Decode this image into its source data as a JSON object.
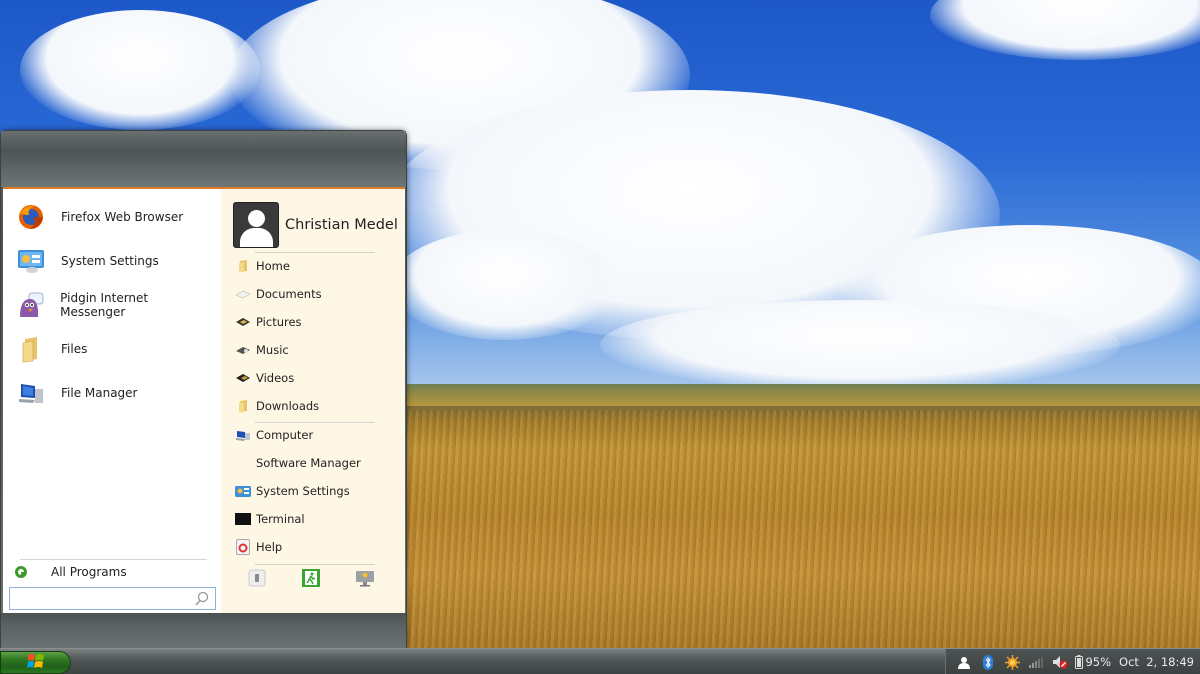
{
  "desktop": {
    "wallpaper": "Wheat field under blue sky with clouds"
  },
  "start_menu": {
    "pinned_apps": [
      {
        "label": "Firefox Web Browser",
        "icon": "firefox-icon"
      },
      {
        "label": "System Settings",
        "icon": "system-settings-icon"
      },
      {
        "label": "Pidgin Internet Messenger",
        "icon": "pidgin-icon"
      },
      {
        "label": "Files",
        "icon": "folder-icon"
      },
      {
        "label": "File Manager",
        "icon": "computer-icon"
      }
    ],
    "all_programs_label": "All Programs",
    "search": {
      "value": "",
      "placeholder": ""
    },
    "user": {
      "name": "Christian Medel"
    },
    "places": [
      {
        "label": "Home",
        "icon": "folder-icon"
      },
      {
        "label": "Documents",
        "icon": "documents-icon"
      },
      {
        "label": "Pictures",
        "icon": "pictures-icon"
      },
      {
        "label": "Music",
        "icon": "music-icon"
      },
      {
        "label": "Videos",
        "icon": "videos-icon"
      },
      {
        "label": "Downloads",
        "icon": "folder-icon"
      }
    ],
    "system": [
      {
        "label": "Computer",
        "icon": "computer-icon"
      },
      {
        "label": "Software Manager",
        "icon": ""
      },
      {
        "label": "System Settings",
        "icon": "system-settings-icon"
      },
      {
        "label": "Terminal",
        "icon": "terminal-icon"
      },
      {
        "label": "Help",
        "icon": "help-icon"
      }
    ],
    "actions": [
      {
        "name": "lock-screen",
        "icon": "lock-icon"
      },
      {
        "name": "logout",
        "icon": "exit-icon"
      },
      {
        "name": "shutdown",
        "icon": "monitor-icon"
      }
    ]
  },
  "taskbar": {
    "tray": {
      "battery_percent": "95%",
      "datetime": "Oct  2, 18:49",
      "icons": [
        "user-icon",
        "bluetooth-icon",
        "update-icon",
        "network-signal-icon",
        "volume-muted-icon",
        "battery-icon"
      ]
    },
    "colors": {
      "start_button": "#2f7a22",
      "menu_accent": "#e07b2a"
    }
  }
}
